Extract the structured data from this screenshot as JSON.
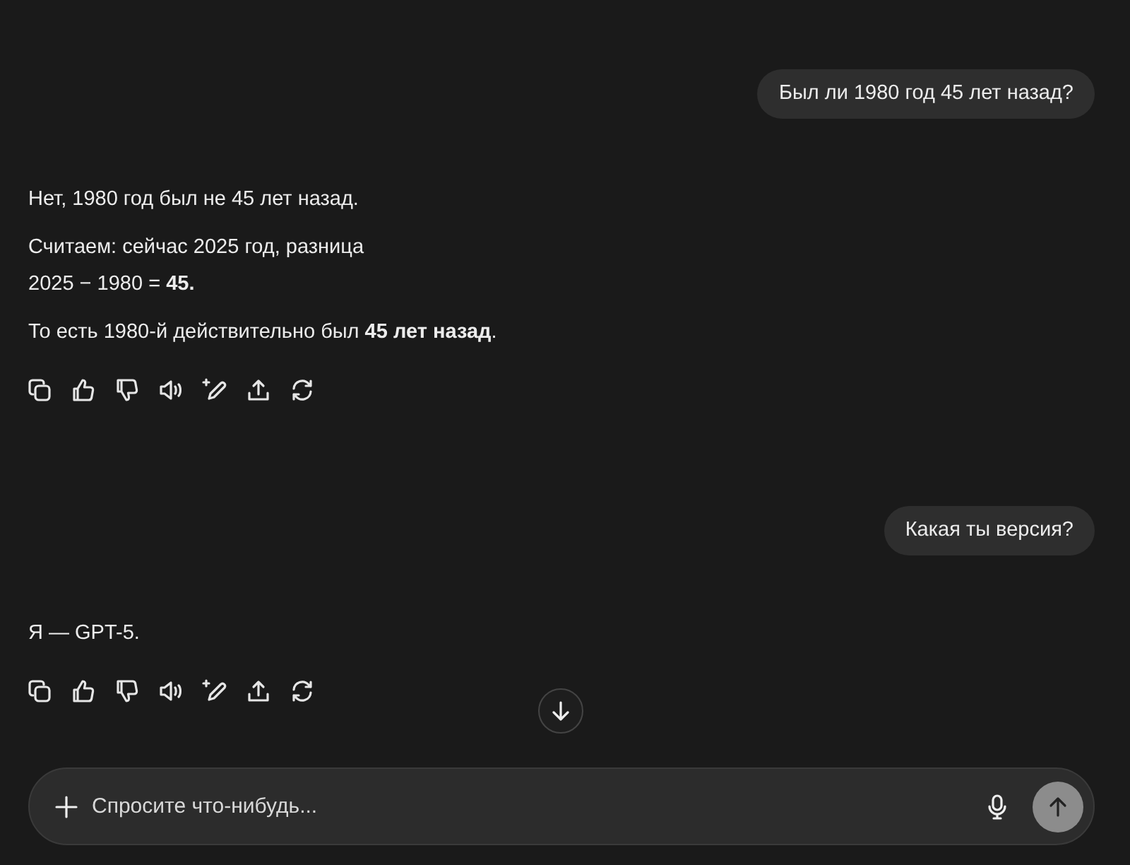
{
  "messages": [
    {
      "kind": "user",
      "text": "Был ли 1980 год 45 лет назад?"
    },
    {
      "kind": "assistant",
      "paragraphs": [
        [
          "Нет, 1980 год был не 45 лет назад."
        ],
        [
          "Считаем: сейчас 2025 год, разница",
          "2025 − 1980 = **45.**"
        ],
        [
          "То есть 1980-й действительно был **45 лет назад**."
        ]
      ]
    },
    {
      "kind": "user",
      "text": "Какая ты версия?"
    },
    {
      "kind": "assistant",
      "paragraphs": [
        [
          "Я — GPT-5."
        ]
      ]
    }
  ],
  "composer": {
    "placeholder": "Спросите что-нибудь..."
  }
}
